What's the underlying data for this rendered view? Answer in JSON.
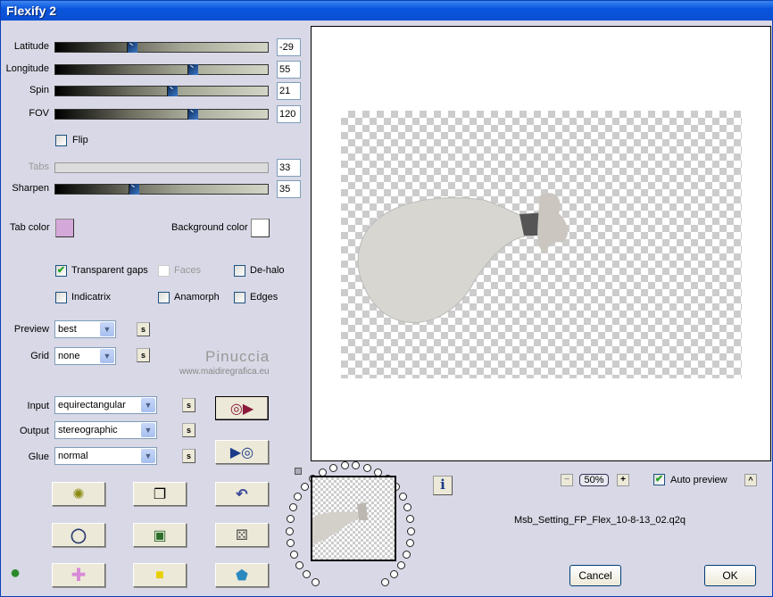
{
  "window": {
    "title": "Flexify 2"
  },
  "sliders": [
    {
      "label": "Latitude",
      "value": "-29",
      "fraction": 0.35,
      "enabled": true
    },
    {
      "label": "Longitude",
      "value": "55",
      "fraction": 0.65,
      "enabled": true
    },
    {
      "label": "Spin",
      "value": "21",
      "fraction": 0.55,
      "enabled": true
    },
    {
      "label": "FOV",
      "value": "120",
      "fraction": 0.65,
      "enabled": true
    },
    {
      "label": "Tabs",
      "value": "33",
      "fraction": null,
      "enabled": false
    },
    {
      "label": "Sharpen",
      "value": "35",
      "fraction": 0.36,
      "enabled": true
    }
  ],
  "flip": {
    "label": "Flip",
    "checked": false
  },
  "colors": {
    "tab_color_label": "Tab color",
    "tab_color": "#d4a8d8",
    "background_color_label": "Background color",
    "background_color": "#ffffff"
  },
  "options": [
    {
      "label": "Transparent gaps",
      "checked": true,
      "enabled": true
    },
    {
      "label": "Faces",
      "checked": false,
      "enabled": false
    },
    {
      "label": "De-halo",
      "checked": false,
      "enabled": true
    },
    {
      "label": "Indicatrix",
      "checked": false,
      "enabled": true
    },
    {
      "label": "Anamorph",
      "checked": false,
      "enabled": true
    },
    {
      "label": "Edges",
      "checked": false,
      "enabled": true
    }
  ],
  "preview_select": {
    "label": "Preview",
    "value": "best"
  },
  "grid_select": {
    "label": "Grid",
    "value": "none"
  },
  "input_select": {
    "label": "Input",
    "value": "equirectangular"
  },
  "output_select": {
    "label": "Output",
    "value": "stereographic"
  },
  "glue_select": {
    "label": "Glue",
    "value": "normal"
  },
  "s_label": "s",
  "watermark": {
    "name": "Pinuccia",
    "url": "www.maidiregrafica.eu"
  },
  "zoom": {
    "minus": "−",
    "value": "50%",
    "plus": "+"
  },
  "auto_preview": {
    "label": "Auto preview",
    "checked": true
  },
  "collapse_label": "^",
  "info_label": "i",
  "settings_file": "Msb_Setting_FP_Flex_10-8-13_02.q2q",
  "cancel_label": "Cancel",
  "ok_label": "OK"
}
